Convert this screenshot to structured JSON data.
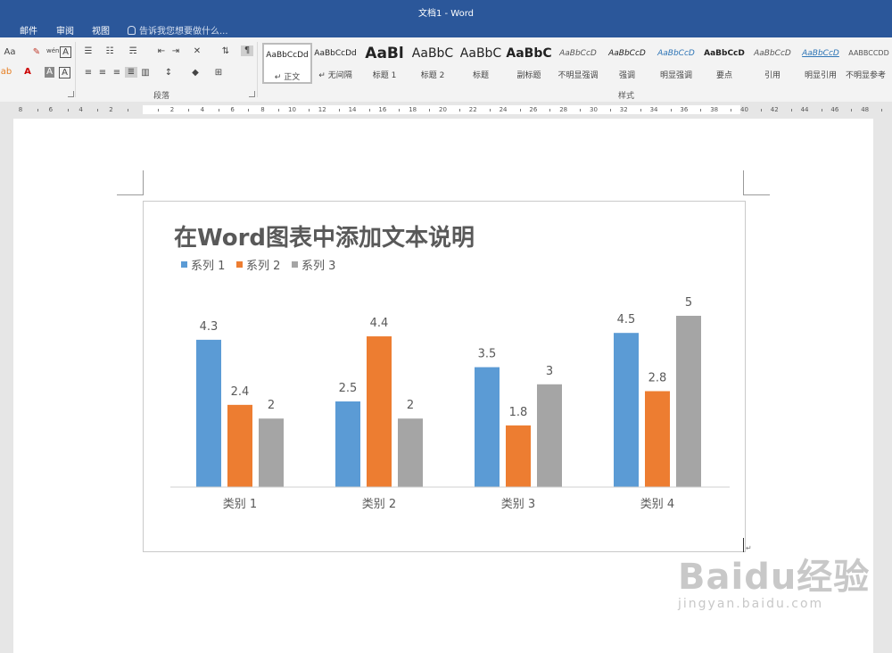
{
  "window": {
    "title": "文档1 - Word"
  },
  "menu": {
    "items": [
      "邮件",
      "审阅",
      "视图"
    ],
    "tell_me": "告诉我您想要做什么..."
  },
  "ribbon": {
    "paragraph_group_label": "段落",
    "styles_group_label": "样式",
    "font_row": {
      "aa_label": "Aa",
      "wen_label": "wén",
      "a_label": "A"
    },
    "styles": [
      {
        "sample": "AaBbCcDd",
        "name": "↵ 正文",
        "selected": true
      },
      {
        "sample": "AaBbCcDd",
        "name": "↵ 无间隔"
      },
      {
        "sample": "AaBl",
        "name": "标题 1"
      },
      {
        "sample": "AaBbC",
        "name": "标题 2"
      },
      {
        "sample": "AaBbC",
        "name": "标题"
      },
      {
        "sample": "AaBbC",
        "name": "副标题"
      },
      {
        "sample": "AaBbCcD",
        "name": "不明显强调"
      },
      {
        "sample": "AaBbCcD",
        "name": "强调"
      },
      {
        "sample": "AaBbCcD",
        "name": "明显强调"
      },
      {
        "sample": "AaBbCcD",
        "name": "要点"
      },
      {
        "sample": "AaBbCcD",
        "name": "引用"
      },
      {
        "sample": "AaBbCcD",
        "name": "明显引用"
      },
      {
        "sample": "AABBCCDD",
        "name": "不明显参考"
      }
    ]
  },
  "ruler": {
    "left_numbers": [
      "8",
      "6",
      "4",
      "2"
    ],
    "numbers": [
      "2",
      "4",
      "6",
      "8",
      "10",
      "12",
      "14",
      "16",
      "18",
      "20",
      "22",
      "24",
      "26",
      "28",
      "30",
      "32",
      "34",
      "36",
      "38"
    ],
    "right_numbers": [
      "40",
      "42",
      "44",
      "46",
      "48"
    ]
  },
  "chart_data": {
    "type": "bar",
    "title": "在Word图表中添加文本说明",
    "categories": [
      "类别 1",
      "类别 2",
      "类别 3",
      "类别 4"
    ],
    "series": [
      {
        "name": "系列 1",
        "values": [
          4.3,
          2.5,
          3.5,
          4.5
        ],
        "color": "#5b9bd5"
      },
      {
        "name": "系列 2",
        "values": [
          2.4,
          4.4,
          1.8,
          2.8
        ],
        "color": "#ed7d31"
      },
      {
        "name": "系列 3",
        "values": [
          2,
          2,
          3,
          5
        ],
        "color": "#a5a5a5"
      }
    ],
    "ylim": [
      0,
      5
    ],
    "legend_position": "top-left",
    "grid": false,
    "data_labels": true
  },
  "watermark": {
    "brand": "Baidu经验",
    "url": "jingyan.baidu.com"
  }
}
